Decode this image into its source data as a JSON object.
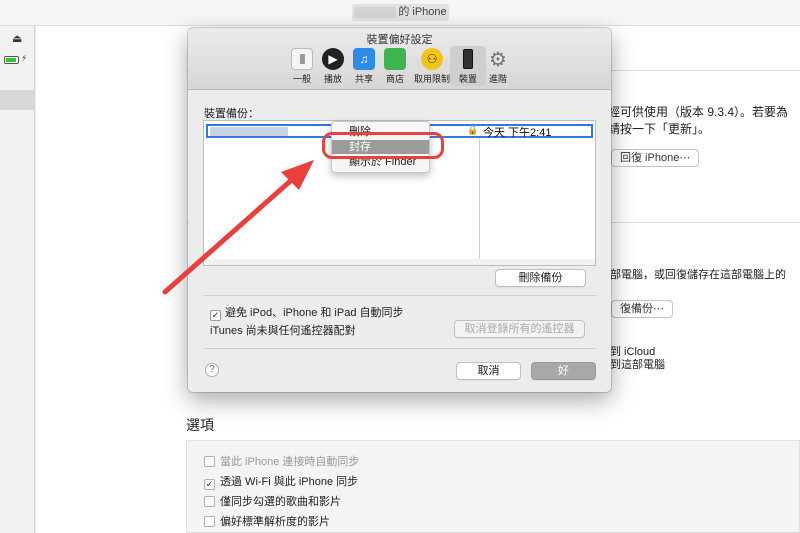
{
  "topbar": {
    "device_name": "的 iPhone"
  },
  "sidebar": {
    "eject_icon": "eject-icon",
    "battery_icon": "battery-icon"
  },
  "background": {
    "version_line1": "已經可供使用（版本 9.3.4）。若要為",
    "version_line2": "，請按一下「更新」。",
    "restore_button": "回復 iPhone⋯",
    "backup_line": "部電腦，或回復儲存在這部電腦上的",
    "restore_backup_button": "復備份⋯",
    "icloud_line1": "到 iCloud",
    "icloud_line2": "到這部電腦"
  },
  "options": {
    "title": "選項",
    "items": [
      {
        "label": "當此 iPhone 連接時自動同步",
        "checked": false,
        "disabled": true
      },
      {
        "label": "透過 Wi-Fi 與此 iPhone 同步",
        "checked": true,
        "disabled": false
      },
      {
        "label": "僅同步勾選的歌曲和影片",
        "checked": false,
        "disabled": false
      },
      {
        "label": "偏好標準解析度的影片",
        "checked": false,
        "disabled": false
      }
    ]
  },
  "dialog": {
    "title": "裝置偏好設定",
    "toolbar": [
      {
        "label": "一般",
        "icon": "switch-icon"
      },
      {
        "label": "播放",
        "icon": "play-icon"
      },
      {
        "label": "共享",
        "icon": "music-share-icon"
      },
      {
        "label": "商店",
        "icon": "store-bag-icon"
      },
      {
        "label": "取用限制",
        "icon": "parental-icon"
      },
      {
        "label": "裝置",
        "icon": "iphone-icon",
        "selected": true
      },
      {
        "label": "進階",
        "icon": "gear-icon"
      }
    ],
    "backup_label": "裝置備份：",
    "backup_row": {
      "date": "今天 下午2:41",
      "locked": true
    },
    "delete_backup_button": "刪除備份",
    "prevent_sync_label": "避免 iPod、iPhone 和 iPad 自動同步",
    "prevent_sync_checked": true,
    "remote_text": "iTunes 尚未與任何遙控器配對",
    "forget_remotes_button": "取消登錄所有的遙控器",
    "help_label": "?",
    "cancel_button": "取消",
    "ok_button": "好"
  },
  "context_menu": {
    "items": [
      {
        "label": "刪除",
        "highlighted": false
      },
      {
        "label": "封存",
        "highlighted": true
      },
      {
        "label": "顯示於 Finder",
        "highlighted": false
      }
    ]
  },
  "colors": {
    "annotation_red": "#e8403f",
    "selection_blue": "#3478d8"
  }
}
